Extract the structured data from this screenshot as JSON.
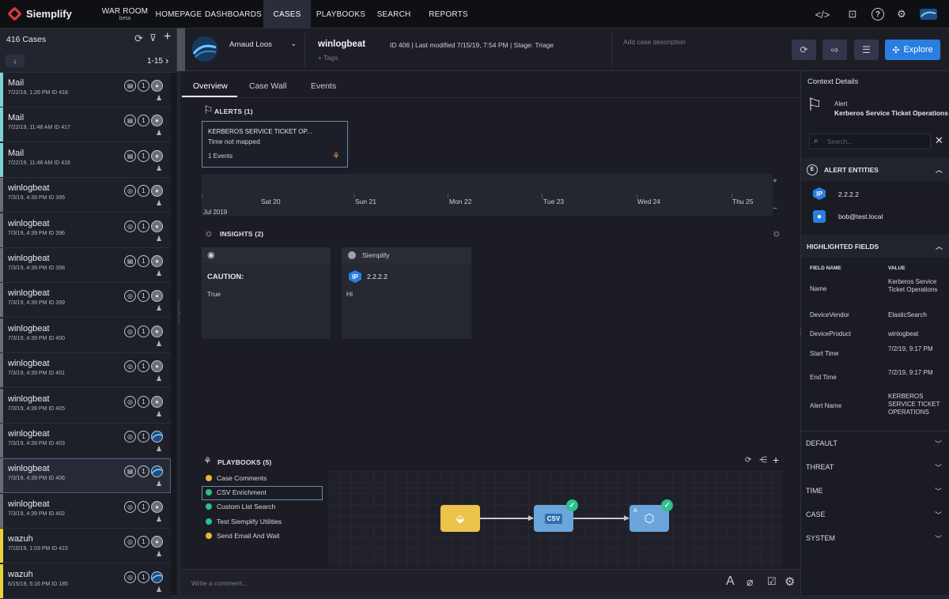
{
  "app": {
    "name": "Siemplify"
  },
  "nav": [
    {
      "label": "WAR ROOM",
      "sub": "beta"
    },
    {
      "label": "HOMEPAGE"
    },
    {
      "label": "DASHBOARDS"
    },
    {
      "label": "CASES"
    },
    {
      "label": "PLAYBOOKS"
    },
    {
      "label": "SEARCH"
    },
    {
      "label": "REPORTS"
    }
  ],
  "case_list": {
    "count_label": "416 Cases",
    "range_label": "1-15",
    "sort_label": "↓",
    "items": [
      {
        "title": "Mail",
        "meta": "7/22/19, 1:26 PM  ID 418",
        "stripe": "#7ed3d6",
        "icon": "email-icon",
        "avatar": "user"
      },
      {
        "title": "Mail",
        "meta": "7/22/19, 11:48 AM  ID 417",
        "stripe": "#7ed3d6",
        "icon": "email-icon",
        "avatar": "user"
      },
      {
        "title": "Mail",
        "meta": "7/22/19, 11:48 AM  ID 416",
        "stripe": "#7ed3d6",
        "icon": "email-icon",
        "avatar": "user"
      },
      {
        "title": "winlogbeat",
        "meta": "7/3/19, 4:39 PM  ID 395",
        "stripe": "#6a6c74",
        "icon": "target-icon",
        "avatar": "user"
      },
      {
        "title": "winlogbeat",
        "meta": "7/3/19, 4:39 PM  ID 396",
        "stripe": "#6a6c74",
        "icon": "target-icon",
        "avatar": "user"
      },
      {
        "title": "winlogbeat",
        "meta": "7/3/19, 4:39 PM  ID 398",
        "stripe": "#6a6c74",
        "icon": "list-icon",
        "avatar": "user"
      },
      {
        "title": "winlogbeat",
        "meta": "7/3/19, 4:39 PM  ID 399",
        "stripe": "#6a6c74",
        "icon": "target-icon",
        "avatar": "user"
      },
      {
        "title": "winlogbeat",
        "meta": "7/3/19, 4:39 PM  ID 400",
        "stripe": "#6a6c74",
        "icon": "target-icon",
        "avatar": "user"
      },
      {
        "title": "winlogbeat",
        "meta": "7/3/19, 4:39 PM  ID 401",
        "stripe": "#6a6c74",
        "icon": "target-icon",
        "avatar": "user"
      },
      {
        "title": "winlogbeat",
        "meta": "7/3/19, 4:39 PM  ID 405",
        "stripe": "#6a6c74",
        "icon": "target-icon",
        "avatar": "user"
      },
      {
        "title": "winlogbeat",
        "meta": "7/3/19, 4:39 PM  ID 403",
        "stripe": "#6a6c74",
        "icon": "target-icon",
        "avatar": "photo"
      },
      {
        "title": "winlogbeat",
        "meta": "7/3/19, 4:39 PM  ID 406",
        "stripe": "#6a6c74",
        "icon": "list-icon",
        "avatar": "photo",
        "selected": true
      },
      {
        "title": "winlogbeat",
        "meta": "7/3/19, 4:39 PM  ID 402",
        "stripe": "#6a6c74",
        "icon": "target-icon",
        "avatar": "user"
      },
      {
        "title": "wazuh",
        "meta": "7/10/19, 1:03 PM  ID 415",
        "stripe": "#e8d43a",
        "icon": "target-icon",
        "avatar": "user"
      },
      {
        "title": "wazuh",
        "meta": "6/15/19, 5:16 PM  ID 185",
        "stripe": "#e8d43a",
        "icon": "target-icon",
        "avatar": "photo"
      }
    ]
  },
  "case_header": {
    "assignee": "Arnaud Loos",
    "title": "winlogbeat",
    "tags_placeholder": "+ Tags",
    "info": "ID 406 | Last modified 7/15/19, 7:54 PM | Stage: Triage",
    "description_placeholder": "Add case description",
    "explore_label": "Explore"
  },
  "tabs": [
    "Overview",
    "Case Wall",
    "Events"
  ],
  "alerts": {
    "header": "ALERTS (1)",
    "card": {
      "title": "KERBEROS SERVICE TICKET OP...",
      "subtitle": "Time not mapped",
      "events": "1 Events"
    }
  },
  "timeline": {
    "days": [
      "Sat 20",
      "Sun 21",
      "Mon 22",
      "Tue 23",
      "Wed 24",
      "Thu 25"
    ],
    "month": "Jul 2019"
  },
  "insights": {
    "header": "INSIGHTS (2)",
    "cards": [
      {
        "source": "",
        "title": "CAUTION:",
        "body": "True"
      },
      {
        "source": "Siemplify",
        "entity_badge": "IP",
        "entity": "2.2.2.2",
        "body": "Hi"
      }
    ]
  },
  "playbooks": {
    "header": "PLAYBOOKS (5)",
    "items": [
      {
        "label": "Case Comments",
        "color": "#e6b93a"
      },
      {
        "label": "CSV Enrichment",
        "color": "#2cc08a",
        "selected": true
      },
      {
        "label": "Custom List Search",
        "color": "#2cc08a"
      },
      {
        "label": "Test Siemplify Utilities",
        "color": "#2cc08a"
      },
      {
        "label": "Send Email And Wait",
        "color": "#e6b93a"
      }
    ],
    "csv_label": "CSV",
    "node_letter": "A"
  },
  "comment": {
    "placeholder": "Write a comment..."
  },
  "context": {
    "title": "Context Details",
    "alert_label": "Alert",
    "alert_name": "Kerberos Service Ticket Operations",
    "search_placeholder": "Search...",
    "entities_header": "ALERT ENTITIES",
    "entities": [
      {
        "badge": "IP",
        "label": "2.2.2.2"
      },
      {
        "badge": "user",
        "label": "bob@test.local"
      }
    ],
    "highlighted_header": "HIGHLIGHTED FIELDS",
    "field_col": "FIELD NAME",
    "value_col": "VALUE",
    "fields": [
      {
        "name": "Name",
        "value": "Kerberos Service Ticket Operations"
      },
      {
        "name": "DeviceVendor",
        "value": "ElasticSearch"
      },
      {
        "name": "DeviceProduct",
        "value": "winlogbeat"
      },
      {
        "name": "Start Time",
        "value": "7/2/19, 9:17 PM"
      },
      {
        "name": "End Time",
        "value": "7/2/19, 9:17 PM"
      },
      {
        "name": "Alert Name",
        "value": "KERBEROS SERVICE TICKET OPERATIONS"
      }
    ],
    "sections": [
      "DEFAULT",
      "THREAT",
      "TIME",
      "CASE",
      "SYSTEM"
    ]
  },
  "colors": {
    "accent": "#2a7ee0",
    "background": "#1c1d24",
    "topbar": "#0f1014",
    "success": "#2cc08a",
    "warning": "#e6b93a"
  }
}
